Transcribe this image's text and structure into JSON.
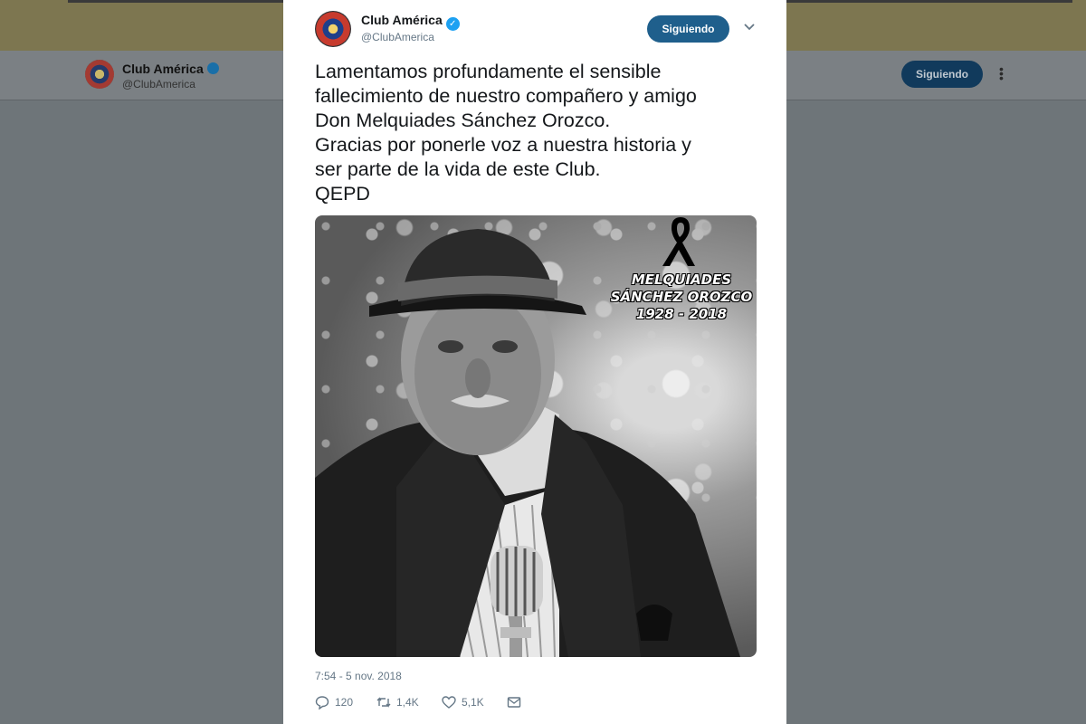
{
  "background": {
    "account_name": "Club América",
    "account_handle": "@ClubAmerica",
    "follow_label": "Siguiendo"
  },
  "tweet": {
    "account_name": "Club América",
    "account_handle": "@ClubAmerica",
    "follow_label": "Siguiendo",
    "text_lines": [
      "Lamentamos profundamente el sensible",
      "fallecimiento de nuestro compañero y amigo",
      "Don Melquiades Sánchez Orozco.",
      "Gracias por ponerle voz a nuestra historia y",
      "ser parte de la vida de este Club.",
      "QEPD"
    ],
    "image": {
      "overlay_name_line1": "MELQUIADES",
      "overlay_name_line2": "SÁNCHEZ OROZCO",
      "overlay_years": "1928 - 2018"
    },
    "timestamp": "7:54 - 5 nov. 2018",
    "actions": {
      "replies": "120",
      "retweets": "1,4K",
      "likes": "5,1K"
    }
  },
  "colors": {
    "follow_button": "#1f5f8c",
    "verified": "#1da1f2",
    "overlay_dim": "#6e7579"
  },
  "icons": [
    "verified-icon",
    "chevron-down-icon",
    "reply-icon",
    "retweet-icon",
    "like-icon",
    "message-icon",
    "more-icon",
    "ribbon-icon"
  ]
}
